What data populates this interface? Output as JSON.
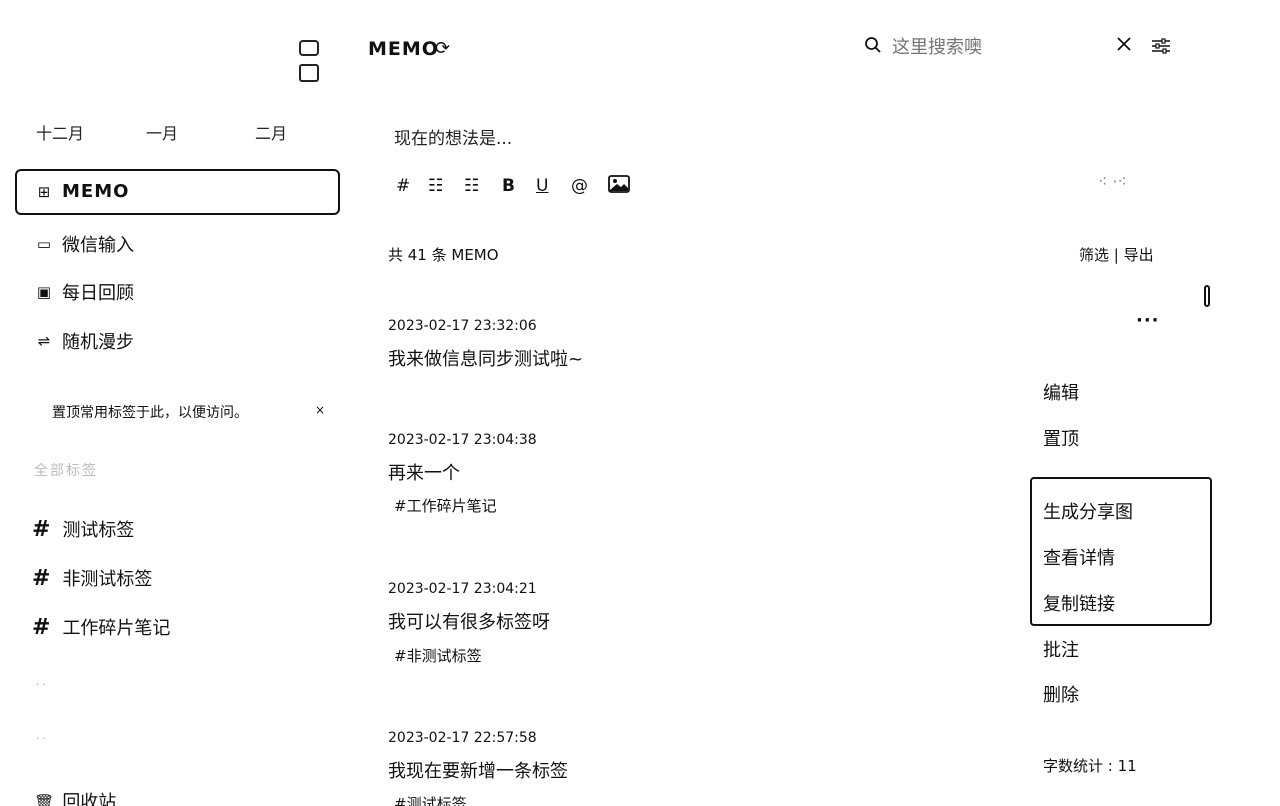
{
  "sidebar": {
    "months": [
      "十二月",
      "一月",
      "二月"
    ],
    "nav": [
      {
        "label": "MEMO",
        "icon": "grid-icon"
      },
      {
        "label": "微信输入",
        "icon": "chat-icon"
      },
      {
        "label": "每日回顾",
        "icon": "calendar-icon"
      },
      {
        "label": "随机漫步",
        "icon": "shuffle-icon"
      }
    ],
    "pin_tip": "置顶常用标签于此，以便访问。",
    "pin_close": "×",
    "tags_head": "全部标签",
    "tags": [
      "测试标签",
      "非测试标签",
      "工作碎片笔记"
    ],
    "tag_hash": "#",
    "recycle": "回收站"
  },
  "header": {
    "title": "MEMO",
    "search_placeholder": "这里搜索噢"
  },
  "editor": {
    "placeholder": "现在的想法是...",
    "tools": [
      "#",
      "☷",
      "☷",
      "B",
      "U",
      "@",
      "🖼"
    ]
  },
  "list": {
    "count": "共 41 条 MEMO",
    "filter_export": "筛选 | 导出",
    "memos": [
      {
        "date": "2023-02-17 23:32:06",
        "text": "我来做信息同步测试啦~",
        "tag": ""
      },
      {
        "date": "2023-02-17 23:04:38",
        "text": "再来一个",
        "tag": "#工作碎片笔记"
      },
      {
        "date": "2023-02-17 23:04:21",
        "text": "我可以有很多标签呀",
        "tag": "#非测试标签"
      },
      {
        "date": "2023-02-17 22:57:58",
        "text": "我现在要新增一条标签",
        "tag": "#测试标签"
      }
    ]
  },
  "menu": {
    "items": [
      "编辑",
      "置顶",
      "生成分享图",
      "查看详情",
      "复制链接",
      "批注",
      "删除"
    ],
    "word_count": "字数统计 : 11"
  }
}
